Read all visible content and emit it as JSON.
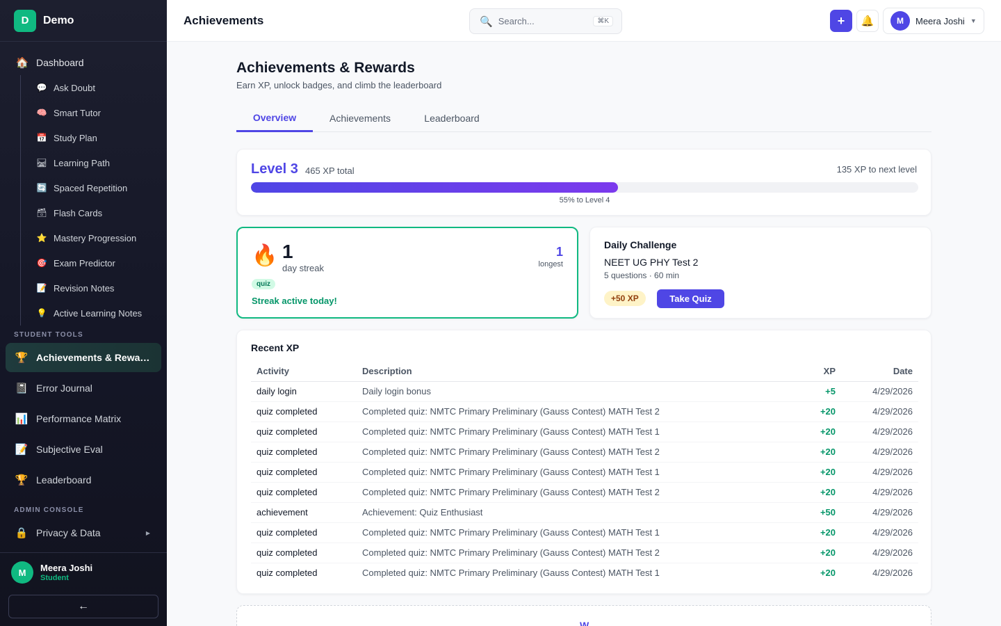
{
  "brand": {
    "logo_letter": "D",
    "name": "Demo"
  },
  "sidebar": {
    "dashboard": {
      "label": "Dashboard",
      "icon": "house-icon"
    },
    "sub_items": [
      {
        "label": "Ask Doubt",
        "icon": "speech-bubble-icon"
      },
      {
        "label": "Smart Tutor",
        "icon": "brain-icon"
      },
      {
        "label": "Study Plan",
        "icon": "calendar-icon"
      },
      {
        "label": "Learning Path",
        "icon": "railway-track-icon"
      },
      {
        "label": "Spaced Repetition",
        "icon": "repeat-icon"
      },
      {
        "label": "Flash Cards",
        "icon": "card-box-icon"
      },
      {
        "label": "Mastery Progression",
        "icon": "star-icon"
      },
      {
        "label": "Exam Predictor",
        "icon": "target-icon"
      },
      {
        "label": "Revision Notes",
        "icon": "memo-icon"
      },
      {
        "label": "Active Learning Notes",
        "icon": "light-bulb-icon"
      }
    ],
    "student_tools_label": "STUDENT TOOLS",
    "student_tools": [
      {
        "label": "Achievements & Rewards",
        "icon": "trophy-icon",
        "active": true
      },
      {
        "label": "Error Journal",
        "icon": "notebook-icon"
      },
      {
        "label": "Performance Matrix",
        "icon": "bar-chart-icon"
      },
      {
        "label": "Subjective Eval",
        "icon": "memo-icon"
      },
      {
        "label": "Leaderboard",
        "icon": "trophy-icon"
      }
    ],
    "admin_label": "ADMIN CONSOLE",
    "admin_items": [
      {
        "label": "Privacy & Data",
        "icon": "lock-icon"
      }
    ],
    "footer": {
      "avatar_letter": "M",
      "name": "Meera Joshi",
      "role": "Student",
      "collapse_icon": "arrow-left-icon"
    }
  },
  "header": {
    "title": "Achievements",
    "search_placeholder": "Search...",
    "search_shortcut": "⌘K",
    "user": {
      "avatar_letter": "M",
      "name": "Meera Joshi"
    }
  },
  "page": {
    "title": "Achievements & Rewards",
    "subtitle": "Earn XP, unlock badges, and climb the leaderboard",
    "tabs": [
      {
        "label": "Overview",
        "active": true
      },
      {
        "label": "Achievements"
      },
      {
        "label": "Leaderboard"
      }
    ]
  },
  "level": {
    "title": "Level 3",
    "total": "465 XP total",
    "next": "135 XP to next level",
    "progress_percent": 55,
    "caption": "55% to Level 4"
  },
  "streak": {
    "icon": "fire-icon",
    "days": "1",
    "label": "day streak",
    "longest": "1",
    "longest_label": "longest",
    "tag": "quiz",
    "status": "Streak active today!"
  },
  "challenge": {
    "heading": "Daily Challenge",
    "title": "NEET UG PHY Test 2",
    "meta": "5 questions · 60 min",
    "xp": "+50 XP",
    "button": "Take Quiz"
  },
  "recent_xp": {
    "heading": "Recent XP",
    "columns": [
      "Activity",
      "Description",
      "XP",
      "Date"
    ],
    "rows": [
      {
        "activity": "daily login",
        "description": "Daily login bonus",
        "xp": "+5",
        "date": "4/29/2026"
      },
      {
        "activity": "quiz completed",
        "description": "Completed quiz: NMTC Primary Preliminary (Gauss Contest) MATH Test 2",
        "xp": "+20",
        "date": "4/29/2026"
      },
      {
        "activity": "quiz completed",
        "description": "Completed quiz: NMTC Primary Preliminary (Gauss Contest) MATH Test 1",
        "xp": "+20",
        "date": "4/29/2026"
      },
      {
        "activity": "quiz completed",
        "description": "Completed quiz: NMTC Primary Preliminary (Gauss Contest) MATH Test 2",
        "xp": "+20",
        "date": "4/29/2026"
      },
      {
        "activity": "quiz completed",
        "description": "Completed quiz: NMTC Primary Preliminary (Gauss Contest) MATH Test 1",
        "xp": "+20",
        "date": "4/29/2026"
      },
      {
        "activity": "quiz completed",
        "description": "Completed quiz: NMTC Primary Preliminary (Gauss Contest) MATH Test 2",
        "xp": "+20",
        "date": "4/29/2026"
      },
      {
        "activity": "achievement",
        "description": "Achievement: Quiz Enthusiast",
        "xp": "+50",
        "date": "4/29/2026"
      },
      {
        "activity": "quiz completed",
        "description": "Completed quiz: NMTC Primary Preliminary (Gauss Contest) MATH Test 1",
        "xp": "+20",
        "date": "4/29/2026"
      },
      {
        "activity": "quiz completed",
        "description": "Completed quiz: NMTC Primary Preliminary (Gauss Contest) MATH Test 2",
        "xp": "+20",
        "date": "4/29/2026"
      },
      {
        "activity": "quiz completed",
        "description": "Completed quiz: NMTC Primary Preliminary (Gauss Contest) MATH Test 1",
        "xp": "+20",
        "date": "4/29/2026"
      }
    ]
  },
  "colors": {
    "accent": "#4f46e5",
    "success": "#10b981",
    "sidebar_bg": "#141626"
  }
}
